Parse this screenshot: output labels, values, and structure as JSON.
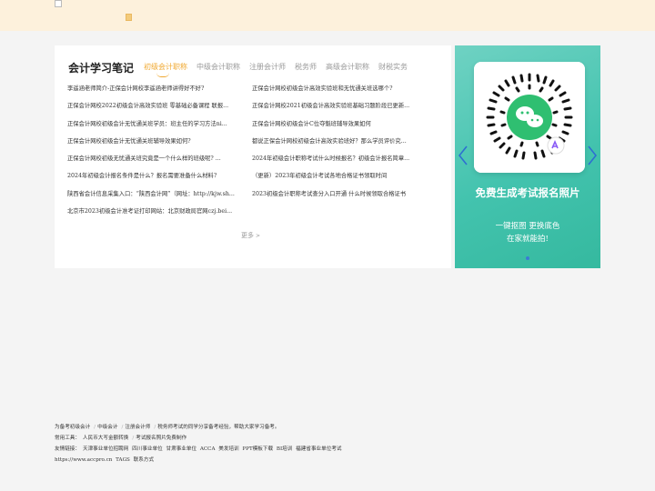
{
  "header": {
    "logo_alt": ""
  },
  "notes": {
    "title": "会计学习笔记",
    "tabs": [
      {
        "label": "初级会计职称",
        "active": true
      },
      {
        "label": "中级会计职称",
        "active": false
      },
      {
        "label": "注册会计师",
        "active": false
      },
      {
        "label": "税务师",
        "active": false
      },
      {
        "label": "高级会计职称",
        "active": false
      },
      {
        "label": "财税实务",
        "active": false
      }
    ],
    "articles": [
      "李遥涵老师简介-正保会计网校李遥涵老师讲得好不好?",
      "正保会计网校初级会计高效实验班和无忧通关班选哪个?",
      "正保会计网校2022初级会计高效实验班 零基础必备课程 联报...",
      "正保会计网校2021初级会计高效实验班基础习题阶段已更新...",
      "正保会计网校初级会计无忧通关班学员：班主任的学习方法ni...",
      "正保会计网校初级会计C位夺魁班辅导效果如何",
      "正保会计网校初级会计无忧通关班辅导效果如何?",
      "都说正保会计网校初级会计高效实验班好？那么学员评价究...",
      "正保会计网校初级无忧通关班究竟是一个什么样的班级呢? ...",
      "2024年初级会计职称考试什么时候报名？初级会计报名简章...",
      "2024年初级会计报名条件是什么？报名需要准备什么材料?",
      "（更新）2023年初级会计考试各地合格证书领取时间",
      "陕西省会计信息采集入口：“陕西会计网”（网址：http://kjw.sh...",
      "2023初级会计职称考试查分入口开通 什么时候领取合格证书",
      "北京市2023初级会计准考证打印网站：北京财政局官网czj.bei..."
    ],
    "more_label": "更多",
    "more_icon": "chevron-right"
  },
  "banner": {
    "headline": "免费生成考试报名照片",
    "sub_line1": "一键抠图 更换底色",
    "sub_line2": "在家就能拍!",
    "prev_icon": "chevron-left",
    "next_icon": "chevron-right",
    "brand_color": "#43c3ae"
  },
  "footer": {
    "line1": [
      "为备考初级会计",
      "中级会计",
      "注册会计师",
      "税务师考试的同学分享备考经验，帮助大家学习备考。"
    ],
    "tools_label": "常用工具：",
    "tools": [
      "人民币大写金额转换",
      "考试报名照片免费制作"
    ],
    "links_label": "友情链接：",
    "links": [
      "天津事业单位招聘网",
      "四川事业单位",
      "甘肃事业单位",
      "ACCA",
      "美发培训",
      "PPT模板下载",
      "BI培训",
      "福建省事业单位考试"
    ],
    "bottom_url": "https://www.accpro.cn",
    "bottom_tags": "TAGS",
    "bottom_contact": "联系方式"
  }
}
